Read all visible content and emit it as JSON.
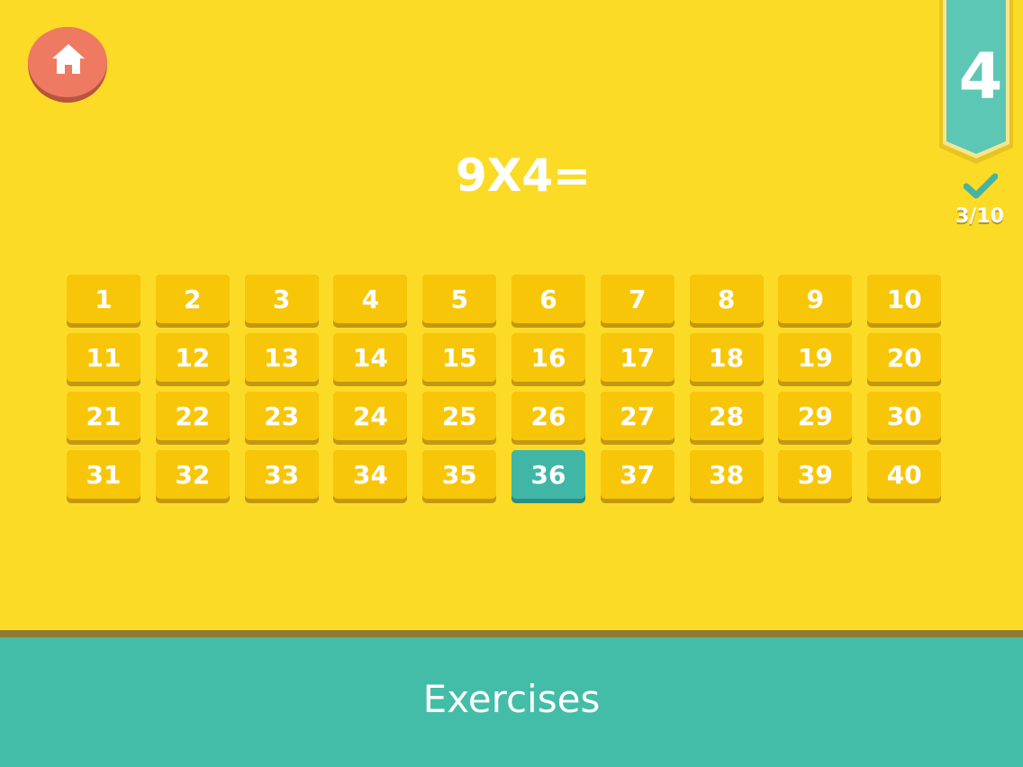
{
  "header": {
    "level": "4",
    "progress": "3/10"
  },
  "question": {
    "text": "9X4="
  },
  "answers": {
    "options": [
      "1",
      "2",
      "3",
      "4",
      "5",
      "6",
      "7",
      "8",
      "9",
      "10",
      "11",
      "12",
      "13",
      "14",
      "15",
      "16",
      "17",
      "18",
      "19",
      "20",
      "21",
      "22",
      "23",
      "24",
      "25",
      "26",
      "27",
      "28",
      "29",
      "30",
      "31",
      "32",
      "33",
      "34",
      "35",
      "36",
      "37",
      "38",
      "39",
      "40"
    ],
    "selected": "36"
  },
  "footer": {
    "title": "Exercises"
  },
  "icons": {
    "home": "home-icon",
    "check": "check-icon"
  },
  "colors": {
    "background": "#fcdb27",
    "tile": "#f8c609",
    "tile_shadow": "#c39813",
    "selected_tile": "#40b7a6",
    "home_button": "#ee7a62",
    "ribbon": "#5cc7b5",
    "footer": "#43bda8"
  }
}
